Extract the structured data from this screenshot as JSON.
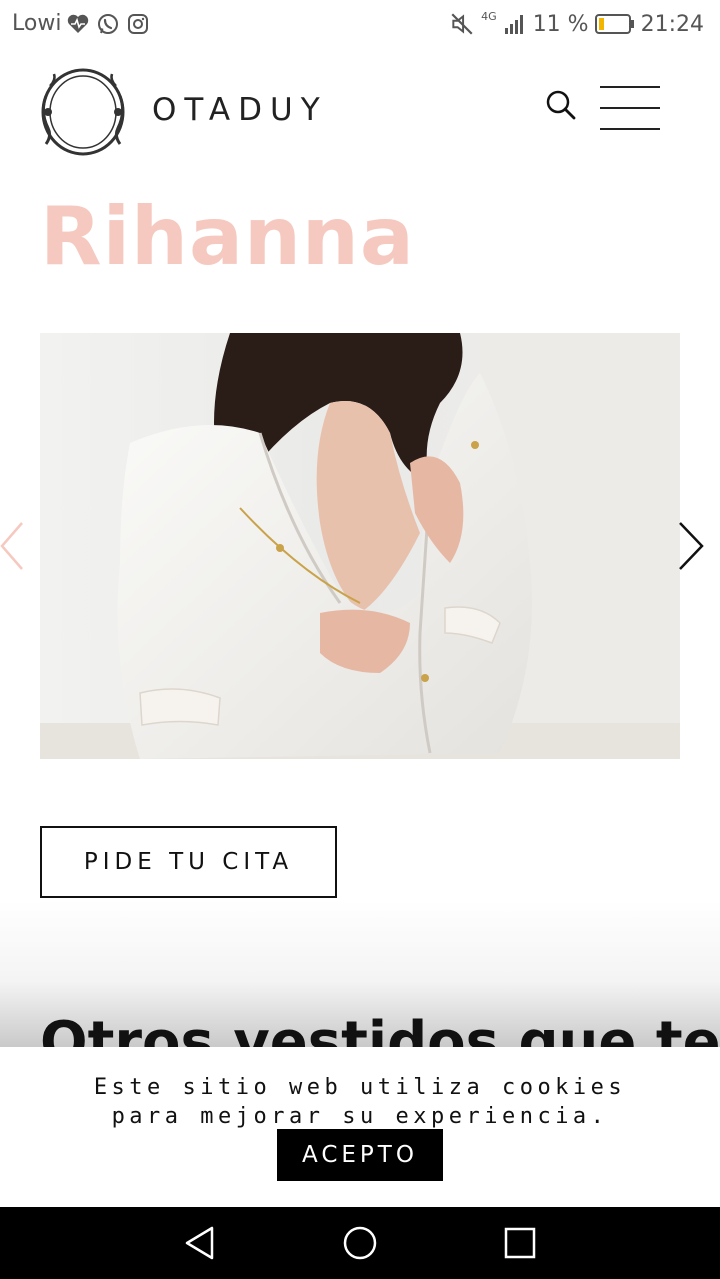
{
  "status_bar": {
    "carrier": "Lowi",
    "battery_percent": "11 %",
    "time": "21:24",
    "network": "4G",
    "icons": [
      "heart-pulse-icon",
      "whatsapp-icon",
      "instagram-icon",
      "mute-icon",
      "signal-icon",
      "battery-icon"
    ]
  },
  "header": {
    "brand": "OTADUY",
    "search_icon": "search-icon",
    "menu_icon": "hamburger-menu-icon"
  },
  "page": {
    "title": "Rihanna",
    "title_color": "#f6c9c0"
  },
  "carousel": {
    "prev_icon": "chevron-left-icon",
    "next_icon": "chevron-right-icon"
  },
  "cta": {
    "label": "PIDE TU CITA"
  },
  "section": {
    "heading": "Otros vestidos que te"
  },
  "cookie": {
    "line1": "Este sitio web utiliza cookies",
    "line2": "para mejorar su experiencia.",
    "accept_label": "ACEPTO"
  },
  "nav_bar": {
    "back_icon": "back-triangle-icon",
    "home_icon": "home-circle-icon",
    "recent_icon": "recent-apps-square-icon"
  }
}
